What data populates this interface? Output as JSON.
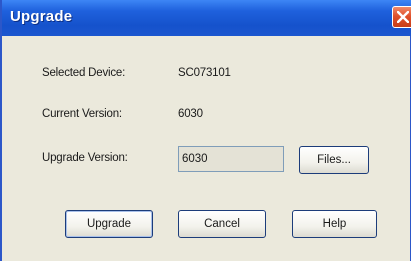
{
  "window": {
    "title": "Upgrade"
  },
  "fields": {
    "selected_device_label": "Selected Device:",
    "selected_device_value": "SC073101",
    "current_version_label": "Current Version:",
    "current_version_value": "6030",
    "upgrade_version_label": "Upgrade Version:",
    "upgrade_version_value": "6030"
  },
  "buttons": {
    "files": "Files...",
    "upgrade": "Upgrade",
    "cancel": "Cancel",
    "help": "Help"
  },
  "icons": {
    "close": "close-icon"
  },
  "colors": {
    "titlebar": "#1f61dd",
    "close_button": "#e0512c",
    "dialog_background": "#ebe9dc"
  }
}
